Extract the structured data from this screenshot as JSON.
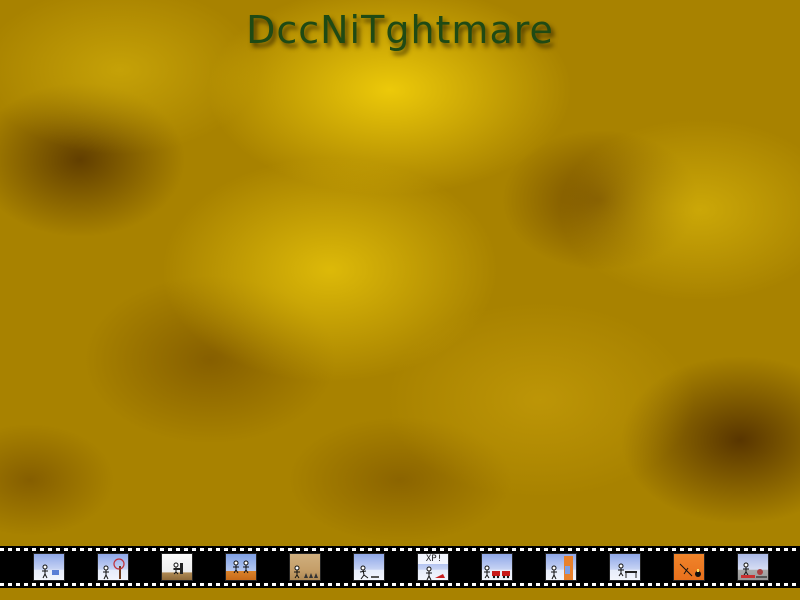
{
  "title": "DccNiTghtmare",
  "filmstrip": {
    "frames": [
      {
        "scene": "stickman-on-hill"
      },
      {
        "scene": "stickman-with-tree"
      },
      {
        "scene": "stickman-with-chair"
      },
      {
        "scene": "two-stickmen"
      },
      {
        "scene": "stickmen-in-desert"
      },
      {
        "scene": "stickman-walking"
      },
      {
        "scene": "stickman-xp",
        "label": "XP!"
      },
      {
        "scene": "stickman-with-red-cars"
      },
      {
        "scene": "stickman-with-door"
      },
      {
        "scene": "stickman-with-table"
      },
      {
        "scene": "stickman-orange-room"
      },
      {
        "scene": "stickman-street"
      }
    ]
  }
}
